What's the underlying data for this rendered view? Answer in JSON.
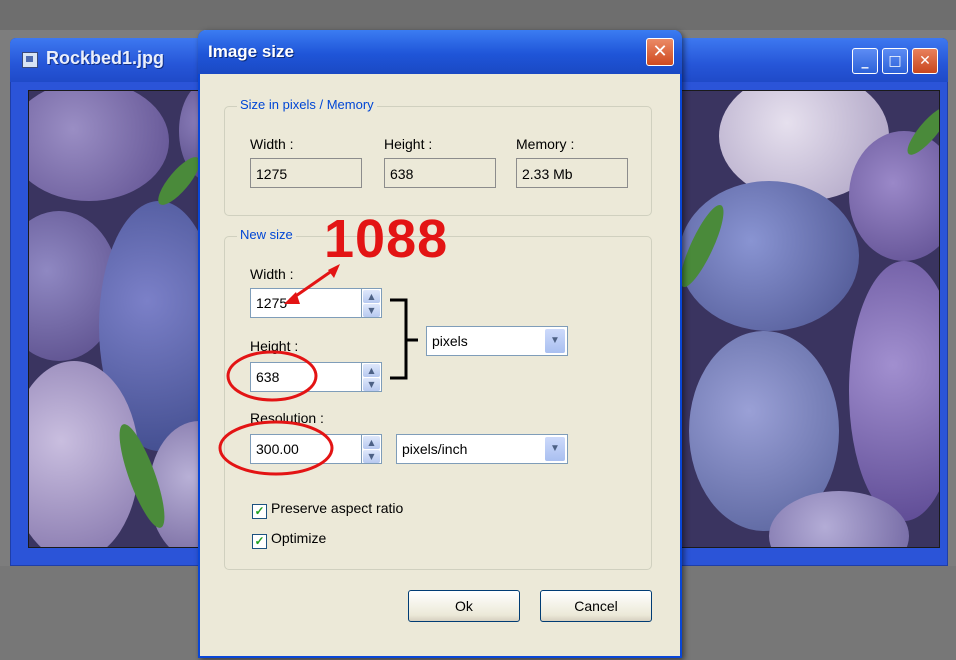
{
  "background_window": {
    "title": "Rockbed1.jpg",
    "controls": {
      "minimize_icon": "minimize-icon",
      "maximize_icon": "maximize-icon",
      "close_icon": "close-icon"
    }
  },
  "dialog": {
    "title": "Image size",
    "size_group": {
      "label": "Size in pixels / Memory",
      "width_label": "Width :",
      "width_value": "1275",
      "height_label": "Height :",
      "height_value": "638",
      "memory_label": "Memory :",
      "memory_value": "2.33 Mb"
    },
    "new_size_group": {
      "label": "New size",
      "width_label": "Width :",
      "width_value": "1275",
      "height_label": "Height :",
      "height_value": "638",
      "unit_value": "pixels",
      "resolution_label": "Resolution :",
      "resolution_value": "300.00",
      "resolution_unit_value": "pixels/inch"
    },
    "preserve_aspect_label": "Preserve aspect ratio",
    "preserve_aspect_checked": true,
    "optimize_label": "Optimize",
    "optimize_checked": true,
    "ok_label": "Ok",
    "cancel_label": "Cancel"
  },
  "annotations": {
    "callout_text": "1088",
    "color": "#e31414"
  }
}
